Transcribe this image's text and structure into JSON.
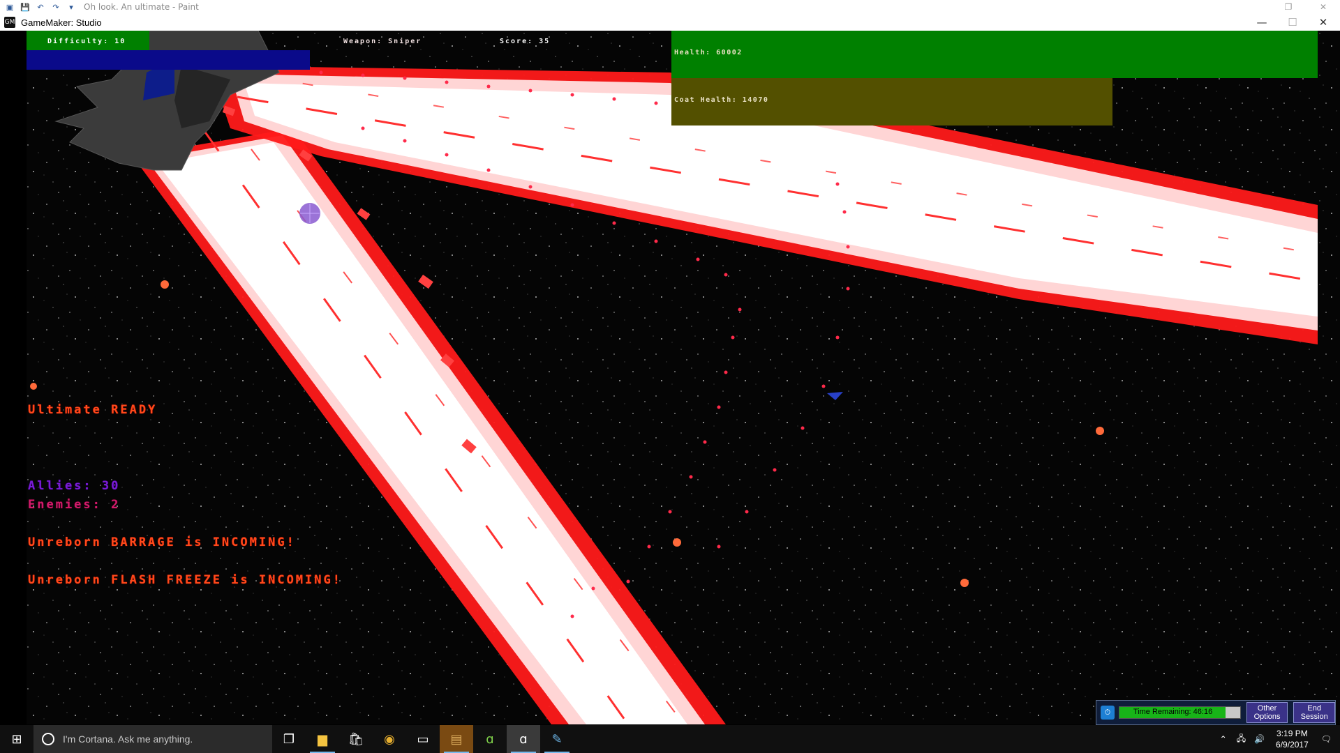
{
  "paint_window": {
    "title": "Oh look. An ultimate - Paint",
    "quick_access": [
      "save-icon",
      "undo-icon",
      "redo-icon",
      "dropdown-icon"
    ]
  },
  "gamemaker_window": {
    "title": "GameMaker: Studio",
    "controls": {
      "minimize": "—",
      "maximize": "☐",
      "close": "✕"
    }
  },
  "hud": {
    "difficulty": "Difficulty: 10",
    "weapon": "Weapon: Sniper",
    "score": "Score: 35",
    "health": "Health: 60002",
    "coat_health": "Coat Health: 14070",
    "ultimate": "Ultimate READY",
    "allies": "Allies: 30",
    "enemies": "Enemies: 2",
    "message_1": "Unreborn BARRAGE is INCOMING!",
    "message_2": "Unreborn FLASH FREEZE is INCOMING!"
  },
  "colors": {
    "health_bar": "#008000",
    "coat_bar": "#535000",
    "laser_glow": "#ff2020",
    "laser_core": "#ffffff",
    "ally_text": "#7a1bd6",
    "enemy_text": "#d21a6a",
    "message_text": "#ff4a1a"
  },
  "timer_widget": {
    "label": "Time Remaining:",
    "time": "46:16",
    "progress": 0.88,
    "other_options": [
      "Other",
      "Options"
    ],
    "end_session": [
      "End",
      "Session"
    ]
  },
  "taskbar": {
    "search_placeholder": "I'm Cortana. Ask me anything.",
    "apps": [
      "task-view-icon",
      "file-explorer-icon",
      "store-icon",
      "chrome-icon",
      "terminal-icon",
      "game-launcher-icon",
      "gamemaker-icon",
      "gamemaker-studio-icon",
      "paint-icon"
    ],
    "time": "3:19 PM",
    "date": "6/9/2017",
    "tray_icons": [
      "chevron-up-icon",
      "network-icon",
      "volume-icon",
      "notification-icon"
    ]
  }
}
